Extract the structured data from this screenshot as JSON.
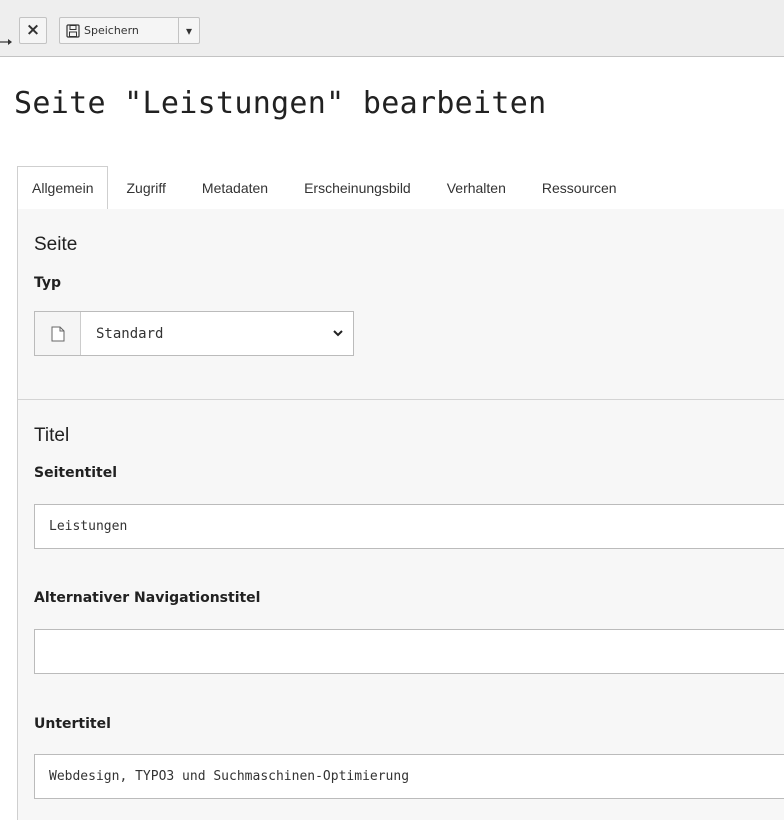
{
  "toolbar": {
    "close_label": "×",
    "save_label": "Speichern",
    "caret": "▾"
  },
  "page": {
    "title": "Seite \"Leistungen\" bearbeiten"
  },
  "tabs": [
    {
      "label": "Allgemein",
      "active": true
    },
    {
      "label": "Zugriff"
    },
    {
      "label": "Metadaten"
    },
    {
      "label": "Erscheinungsbild"
    },
    {
      "label": "Verhalten"
    },
    {
      "label": "Ressourcen"
    }
  ],
  "sections": {
    "seite": {
      "heading": "Seite",
      "typ_label": "Typ",
      "typ_value": "Standard",
      "typ_icon": "page-icon"
    },
    "titel": {
      "heading": "Titel",
      "seitentitel_label": "Seitentitel",
      "seitentitel_value": "Leistungen",
      "navtitel_label": "Alternativer Navigationstitel",
      "navtitel_value": "",
      "untertitel_label": "Untertitel",
      "untertitel_value": "Webdesign, TYPO3 und Suchmaschinen-Optimierung"
    }
  },
  "colors": {
    "toolbar_bg": "#eeeeee",
    "panel_bg": "#f7f7f7",
    "border": "#cfcfcf"
  }
}
